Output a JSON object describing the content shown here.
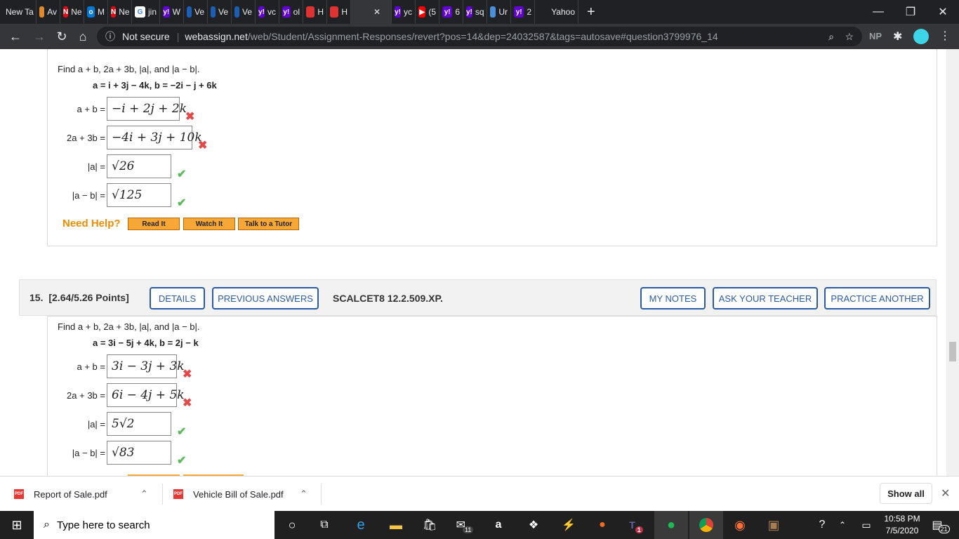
{
  "browser": {
    "tabs": [
      {
        "label": "New Ta",
        "color": "#5f6368",
        "glyph": ""
      },
      {
        "label": "Av",
        "color": "#e08a2a",
        "glyph": ""
      },
      {
        "label": "Ne",
        "color": "#e50914",
        "glyph": "N"
      },
      {
        "label": "M",
        "color": "#0078d4",
        "glyph": "o"
      },
      {
        "label": "Ne",
        "color": "#e50914",
        "glyph": "N"
      },
      {
        "label": "jin",
        "color": "#fff",
        "glyph": "G"
      },
      {
        "label": "W",
        "color": "#6001d2",
        "glyph": "y!"
      },
      {
        "label": "Ve",
        "color": "#1a5fb4",
        "glyph": ""
      },
      {
        "label": "Ve",
        "color": "#1a5fb4",
        "glyph": ""
      },
      {
        "label": "Ve",
        "color": "#1a5fb4",
        "glyph": ""
      },
      {
        "label": "vc",
        "color": "#6001d2",
        "glyph": "y!"
      },
      {
        "label": "ol",
        "color": "#6001d2",
        "glyph": "y!"
      },
      {
        "label": "H",
        "color": "#d33",
        "glyph": ""
      },
      {
        "label": "H",
        "color": "#d33",
        "glyph": ""
      },
      {
        "label": "",
        "color": "#35363a",
        "glyph": "",
        "active": true
      },
      {
        "label": "yc",
        "color": "#6001d2",
        "glyph": "y!"
      },
      {
        "label": "(5",
        "color": "#f00",
        "glyph": "▶"
      },
      {
        "label": "6",
        "color": "#6001d2",
        "glyph": "y!"
      },
      {
        "label": "sq",
        "color": "#6001d2",
        "glyph": "y!"
      },
      {
        "label": "Ur",
        "color": "#4a90d9",
        "glyph": ""
      },
      {
        "label": "2",
        "color": "#6001d2",
        "glyph": "y!"
      },
      {
        "label": "Yahoo",
        "color": "#202124",
        "glyph": ""
      }
    ],
    "new_tab": "+",
    "not_secure": "Not secure",
    "url_host": "webassign.net",
    "url_path": "/web/Student/Assignment-Responses/revert?pos=14&dep=24032587&tags=autosave#question3799976_14",
    "profile": "NP"
  },
  "q14": {
    "prompt": "Find  a + b, 2a + 3b, |a|, and |a − b|.",
    "given": "a = i + 3j − 4k,    b = −2i − j + 6k",
    "rows": [
      {
        "label": "a + b =",
        "answer": "−i + 2j + 2k",
        "result": "wrong"
      },
      {
        "label": "2a + 3b =",
        "answer": "−4i + 3j + 10k",
        "result": "wrong"
      },
      {
        "label": "|a| =",
        "answer": "√26",
        "result": "right"
      },
      {
        "label": "|a − b| =",
        "answer": "√125",
        "result": "right"
      }
    ],
    "need_help": "Need Help?",
    "help_buttons": [
      "Read It",
      "Watch It",
      "Talk to a Tutor"
    ]
  },
  "q15": {
    "number": "15.",
    "points": "[2.64/5.26 Points]",
    "details": "DETAILS",
    "previous": "PREVIOUS ANSWERS",
    "code": "SCALCET8 12.2.509.XP.",
    "my_notes": "MY NOTES",
    "ask_teacher": "ASK YOUR TEACHER",
    "practice": "PRACTICE ANOTHER",
    "prompt": "Find  a + b, 2a + 3b, |a|, and |a − b|.",
    "given": "a = 3i − 5j + 4k,    b = 2j − k",
    "rows": [
      {
        "label": "a + b =",
        "answer": "3i − 3j + 3k",
        "result": "wrong"
      },
      {
        "label": "2a + 3b =",
        "answer": "6i − 4j + 5k",
        "result": "wrong"
      },
      {
        "label": "|a| =",
        "answer": "5√2",
        "result": "right"
      },
      {
        "label": "|a − b| =",
        "answer": "√83",
        "result": "right"
      }
    ]
  },
  "downloads": {
    "items": [
      "Report of Sale.pdf",
      "Vehicle Bill of Sale.pdf"
    ],
    "show_all": "Show all"
  },
  "taskbar": {
    "search_placeholder": "Type here to search",
    "time": "10:58 PM",
    "date": "7/5/2020",
    "notif_count": "21",
    "mail_badge": "11",
    "teams_badge": "1"
  }
}
